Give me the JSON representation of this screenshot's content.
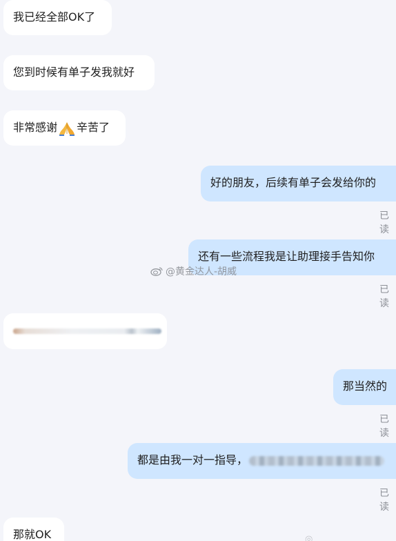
{
  "messages": [
    {
      "side": "left",
      "text": "我已经全部OK了"
    },
    {
      "side": "left",
      "text": "您到时候有单子发我就好"
    },
    {
      "side": "left",
      "text_before": "非常感谢",
      "emoji": "folded-hands-emoji",
      "text_after": "辛苦了"
    },
    {
      "side": "right",
      "text": "好的朋友，后续有单子会发给你的",
      "status": "已读"
    },
    {
      "side": "right",
      "text": "还有一些流程我是让助理接手告知你",
      "status": "已读"
    },
    {
      "side": "left",
      "content": "blurred-content"
    },
    {
      "side": "right",
      "text": "那当然的",
      "status": "已读"
    },
    {
      "side": "right",
      "text": "都是由我一对一指导，",
      "extra": "blurred-content",
      "status": "已读"
    },
    {
      "side": "left",
      "text": "那就OK"
    }
  ],
  "watermark": {
    "text": "@黄金达人-胡威"
  },
  "colors": {
    "background": "#f4f5fa",
    "left_bubble": "#ffffff",
    "right_bubble": "#cfe6ff",
    "read_status": "#8c8f96"
  }
}
